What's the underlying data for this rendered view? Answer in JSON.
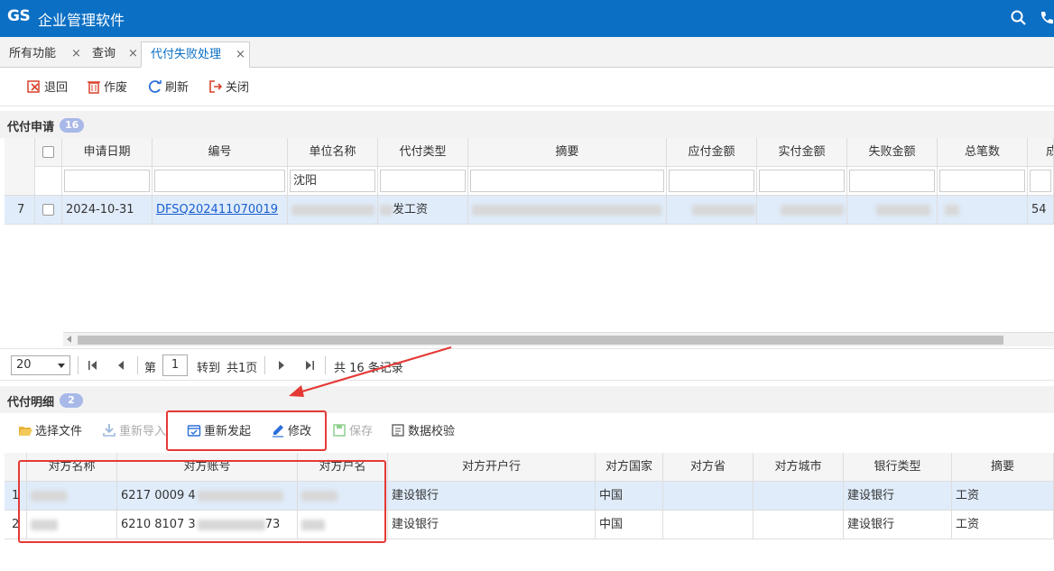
{
  "app": {
    "logo": "GS",
    "title": "企业管理软件"
  },
  "tabs": [
    {
      "label": "所有功能",
      "close": "×"
    },
    {
      "label": "查询",
      "close": "×"
    },
    {
      "label": "代付失败处理",
      "close": "×"
    }
  ],
  "toolbar": {
    "back": "退回",
    "void": "作废",
    "refresh": "刷新",
    "close": "关闭"
  },
  "apply": {
    "title": "代付申请",
    "count": "16",
    "columns": [
      "申请日期",
      "编号",
      "单位名称",
      "代付类型",
      "摘要",
      "应付金额",
      "实付金额",
      "失败金额",
      "总笔数",
      "成"
    ],
    "filter_company": "沈阳",
    "row": {
      "index": "7",
      "date": "2024-10-31",
      "number": "DFSQ202411070019",
      "type_tail": "发工资",
      "total_tail": "54"
    }
  },
  "pager": {
    "page_size": "20",
    "page_prefix": "第",
    "page_value": "1",
    "goto": "转到",
    "total_pages": "共1页",
    "total_records": "共 16 条记录"
  },
  "detail": {
    "title": "代付明细",
    "count": "2",
    "buttons": {
      "select_file": "选择文件",
      "reimport": "重新导入",
      "resend": "重新发起",
      "edit": "修改",
      "save": "保存",
      "validate": "数据校验"
    },
    "columns": [
      "对方名称",
      "对方账号",
      "对方户名",
      "对方开户行",
      "对方国家",
      "对方省",
      "对方城市",
      "银行类型",
      "摘要"
    ],
    "rows": [
      {
        "index": "1",
        "account": "6217 0009 4",
        "bank": "建设银行",
        "country": "中国",
        "bank_type": "建设银行",
        "memo": "工资"
      },
      {
        "index": "2",
        "account": "6210 8107 3",
        "account_tail": "73",
        "bank": "建设银行",
        "country": "中国",
        "bank_type": "建设银行",
        "memo": "工资"
      }
    ]
  }
}
